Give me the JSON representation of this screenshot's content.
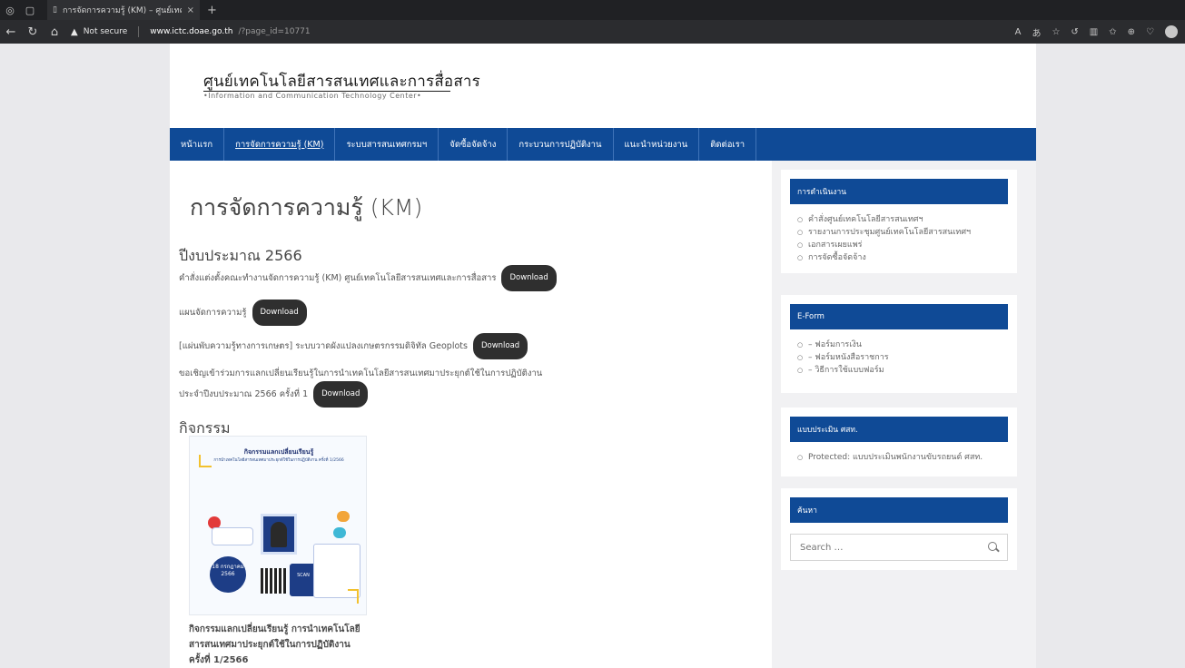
{
  "browser": {
    "tab_title": "การจัดการความรู้ (KM) – ศูนย์เทคโนโล...",
    "tab_close": "×",
    "new_tab": "+",
    "security_label": "Not secure",
    "url_host": "www.ictc.doae.go.th",
    "url_path": "/?page_id=10771"
  },
  "header": {
    "logo_th": "ศูนย์เทคโนโลยีสารสนเทศและการสื่อสาร",
    "logo_en": "•Information and Communication Technology Center•"
  },
  "nav": [
    {
      "label": "หน้าแรก"
    },
    {
      "label": "การจัดการความรู้ (KM)"
    },
    {
      "label": "ระบบสารสนเทศกรมฯ"
    },
    {
      "label": "จัดซื้อจัดจ้าง"
    },
    {
      "label": "กระบวนการปฏิบัติงาน"
    },
    {
      "label": "แนะนำหน่วยงาน"
    },
    {
      "label": "ติดต่อเรา"
    }
  ],
  "content": {
    "title": "การจัดการความรู้ (KM)",
    "section1_heading": "ปีงบประมาณ 2566",
    "items": [
      {
        "text": "คำสั่งแต่งตั้งคณะทำงานจัดการความรู้ (KM) ศูนย์เทคโนโลยีสารสนเทศและการสื่อสาร"
      },
      {
        "text": "แผนจัดการความรู้"
      },
      {
        "text": "[แผ่นพับความรู้ทางการเกษตร] ระบบวาดผังแปลงเกษตรกรรมดิจิทัล Geoplots"
      },
      {
        "text_line1": "ขอเชิญเข้าร่วมการแลกเปลี่ยนเรียนรู้ในการนำเทคโนโลยีสารสนเทศมาประยุกต์ใช้ในการปฏิบัติงาน",
        "text_line2": "ประจำปีงบประมาณ 2566 ครั้งที่ 1"
      }
    ],
    "download_label": "Download",
    "section2_heading": "กิจกรรม",
    "poster": {
      "title": "กิจกรรมแลกเปลี่ยนเรียนรู้",
      "subtitle": "การนำเทคโนโลยีสารสนเทศมาประยุกต์ใช้ในการปฏิบัติงาน ครั้งที่ 1/2566",
      "date": "18 กรกฎาคม 2566",
      "scan": "SCAN"
    },
    "post_caption_lines": [
      "กิจกรรมแลกเปลี่ยนเรียนรู้ การนำเทคโนโลยี",
      "สารสนเทศมาประยุกต์ใช้ในการปฏิบัติงาน",
      "ครั้งที่ 1/2566"
    ]
  },
  "sidebar": {
    "widgets": [
      {
        "title": "การดำเนินงาน",
        "items": [
          "คำสั่งศูนย์เทคโนโลยีสารสนเทศฯ",
          "รายงานการประชุมศูนย์เทคโนโลยีสารสนเทศฯ",
          "เอกสารเผยแพร่",
          "การจัดซื้อจัดจ้าง"
        ]
      },
      {
        "title": "E-Form",
        "items": [
          "– ฟอร์มการเงิน",
          "– ฟอร์มหนังสือราชการ",
          "– วิธีการใช้แบบฟอร์ม"
        ]
      },
      {
        "title": "แบบประเมิน ศสท.",
        "items": [
          "Protected: แบบประเมินพนักงานขับรถยนต์ ศสท."
        ]
      },
      {
        "title": "ค้นหา",
        "search_placeholder": "Search …"
      }
    ]
  }
}
